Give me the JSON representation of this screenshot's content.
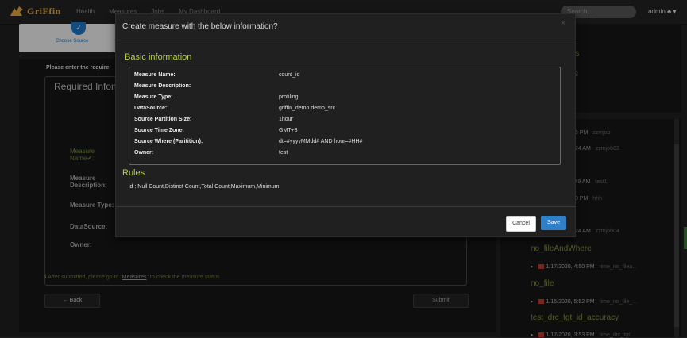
{
  "navbar": {
    "brand": "GriFfin",
    "links": [
      "Health",
      "Measures",
      "Jobs",
      "My Dashboard"
    ],
    "search_placeholder": "Search...",
    "user": "admin ♣ ▾"
  },
  "wizard": {
    "step_label": "Choose Source",
    "step_icon": "✓"
  },
  "form": {
    "hint": "Please enter the require",
    "required_title": "Required Infon",
    "labels": {
      "measure_name": "Measure Name✔:",
      "measure_description": "Measure Description:",
      "measure_type": "Measure Type:",
      "datasource": "DataSource:",
      "owner": "Owner:"
    },
    "footer_prefix": "ℹ After submitted, please go to \"",
    "footer_link": "Measures",
    "footer_suffix": "\" to check the measure status",
    "back": "← Back",
    "submit": "Submit"
  },
  "right_panel": {
    "top_items": [
      "ets",
      "ics"
    ],
    "rows": [
      {
        "time": "), 5:36 PM",
        "owner": "zzmjob"
      },
      {
        "time": "), 10:24 AM",
        "owner": "zzmjob03"
      },
      {
        "time": "), 11:49 AM",
        "owner": "test1"
      },
      {
        "time": "), 2:20 PM",
        "owner": "hhh"
      },
      {
        "time": "), 10:24 AM",
        "owner": "zzmjob04"
      }
    ],
    "measures": [
      {
        "name": "no_fileAndWhere",
        "run": "1/17/2020, 4:50 PM",
        "owner": "time_no_filea..."
      },
      {
        "name": "no_file",
        "run": "1/16/2020, 5:52 PM",
        "owner": "time_no_file_..."
      },
      {
        "name": "test_drc_tgt_id_accuracy",
        "run": "1/17/2020, 3:53 PM",
        "owner": "time_drc_tgt..."
      }
    ]
  },
  "modal": {
    "title": "Create measure with the below information?",
    "close": "×",
    "basic_title": "Basic information",
    "info": [
      {
        "k": "Measure Name:",
        "v": "count_id"
      },
      {
        "k": "Measure Description:",
        "v": ""
      },
      {
        "k": "Measure Type:",
        "v": "profiling"
      },
      {
        "k": "DataSource:",
        "v": "griffin_demo.demo_src"
      },
      {
        "k": "Source Partition Size:",
        "v": "1hour"
      },
      {
        "k": "Source Time Zone:",
        "v": "GMT+8"
      },
      {
        "k": "Source Where (Paritition):",
        "v": "dt=#yyyyMMdd# AND hour=#HH#"
      },
      {
        "k": "Owner:",
        "v": "test"
      }
    ],
    "rules_title": "Rules",
    "rules_text": "id : Null Count,Distinct Count,Total Count,Maximum,Minimum",
    "cancel": "Cancel",
    "save": "Save"
  },
  "colors": {
    "accent_green": "#b7d23a",
    "save_blue": "#2f80c8",
    "brand_orange": "#e8a43a"
  }
}
